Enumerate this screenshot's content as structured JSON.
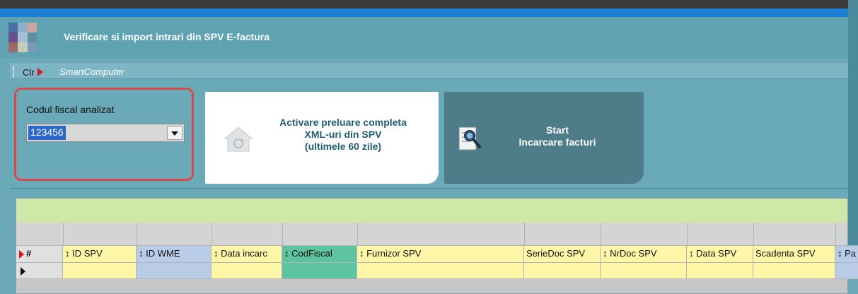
{
  "window": {
    "title": "Verificare si import intrari din SPV E-factura"
  },
  "breadcrumb": {
    "clr_label": "Clr",
    "item": "SmartComputer"
  },
  "filter": {
    "label": "Codul fiscal analizat",
    "value": "123456"
  },
  "buttons": {
    "activate": {
      "line1": "Activare preluare completa",
      "line2": "XML-uri din SPV",
      "line3": "(ultimele 60 zile)"
    },
    "start": {
      "line1": "Start",
      "line2": "Incarcare facturi"
    }
  },
  "grid": {
    "row_marker": "#",
    "columns": [
      {
        "label": "↕ ID SPV",
        "bg": "#fff7a8"
      },
      {
        "label": "↕ ID WME",
        "bg": "#b8cce8"
      },
      {
        "label": "↕ Data incarc",
        "bg": "#fff7a8"
      },
      {
        "label": "↕ CodFiscal",
        "bg": "#5ec4a0"
      },
      {
        "label": "↕ Furnizor SPV",
        "bg": "#fff7a8"
      },
      {
        "label": "SerieDoc SPV",
        "bg": "#fff7a8"
      },
      {
        "label": "↕ NrDoc SPV",
        "bg": "#fff7a8"
      },
      {
        "label": "↕ Data SPV",
        "bg": "#fff7a8"
      },
      {
        "label": "Scadenta SPV",
        "bg": "#fff7a8"
      },
      {
        "label": "↕ Pa",
        "bg": "#b8cce8"
      }
    ]
  },
  "colors": {
    "title_bg": "#5fa3b3",
    "accent_blue": "#1a7fd4",
    "highlight_red": "#d84a4a",
    "selection": "#2b66c8"
  }
}
